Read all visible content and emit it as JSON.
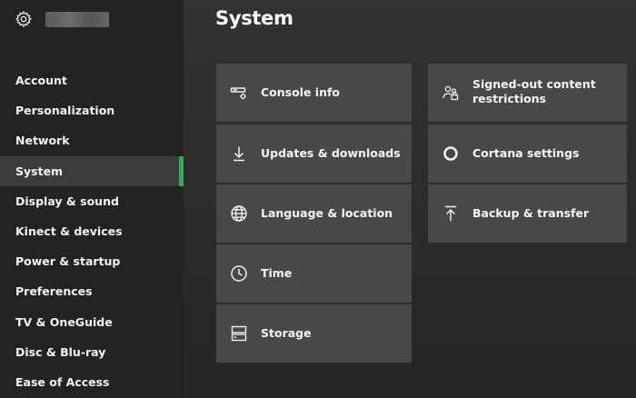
{
  "page": {
    "title": "System"
  },
  "sidebar": {
    "items": [
      {
        "label": "Account"
      },
      {
        "label": "Personalization"
      },
      {
        "label": "Network"
      },
      {
        "label": "System",
        "selected": true
      },
      {
        "label": "Display & sound"
      },
      {
        "label": "Kinect & devices"
      },
      {
        "label": "Power & startup"
      },
      {
        "label": "Preferences"
      },
      {
        "label": "TV & OneGuide"
      },
      {
        "label": "Disc & Blu-ray"
      },
      {
        "label": "Ease of Access"
      }
    ]
  },
  "tiles": {
    "console_info": {
      "label": "Console info",
      "icon": "console-icon"
    },
    "updates": {
      "label": "Updates & downloads",
      "icon": "download-icon"
    },
    "language": {
      "label": "Language & location",
      "icon": "globe-icon"
    },
    "time": {
      "label": "Time",
      "icon": "clock-icon"
    },
    "storage": {
      "label": "Storage",
      "icon": "storage-icon"
    },
    "signed_out": {
      "label": "Signed-out content restrictions",
      "icon": "people-lock-icon"
    },
    "cortana": {
      "label": "Cortana settings",
      "icon": "cortana-icon"
    },
    "backup": {
      "label": "Backup & transfer",
      "icon": "upload-icon"
    }
  },
  "colors": {
    "accent": "#2bb24c",
    "tile": "#4a4846",
    "sidebar": "#232323"
  }
}
